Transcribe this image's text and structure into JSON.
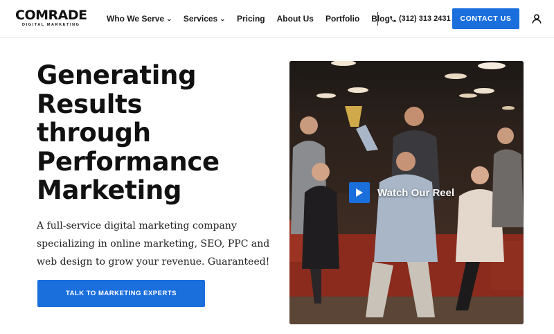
{
  "brand": {
    "name": "COMRADE",
    "tagline": "DIGITAL MARKETING"
  },
  "nav": {
    "items": [
      {
        "label": "Who We Serve",
        "has_dropdown": true
      },
      {
        "label": "Services",
        "has_dropdown": true
      },
      {
        "label": "Pricing",
        "has_dropdown": false
      },
      {
        "label": "About Us",
        "has_dropdown": false
      },
      {
        "label": "Portfolio",
        "has_dropdown": false
      },
      {
        "label": "Blog",
        "has_dropdown": false
      }
    ],
    "phone": "(312) 313 2431",
    "contact_label": "CONTACT US",
    "icons": {
      "dropdown": "chevron-down-icon",
      "phone": "phone-icon",
      "user": "user-icon"
    }
  },
  "hero": {
    "title_lines": [
      "Generating",
      "Results",
      "through",
      "Performance",
      "Marketing"
    ],
    "subtitle": "A full-service digital marketing company specializing in online marketing, SEO, PPC and web design to grow your revenue. Guaranteed!",
    "cta_label": "TALK TO MARKETING EXPERTS",
    "video_label": "Watch Our Reel",
    "video_icon": "play-icon"
  },
  "colors": {
    "accent": "#1a6fdc",
    "text": "#111111",
    "background": "#ffffff"
  }
}
